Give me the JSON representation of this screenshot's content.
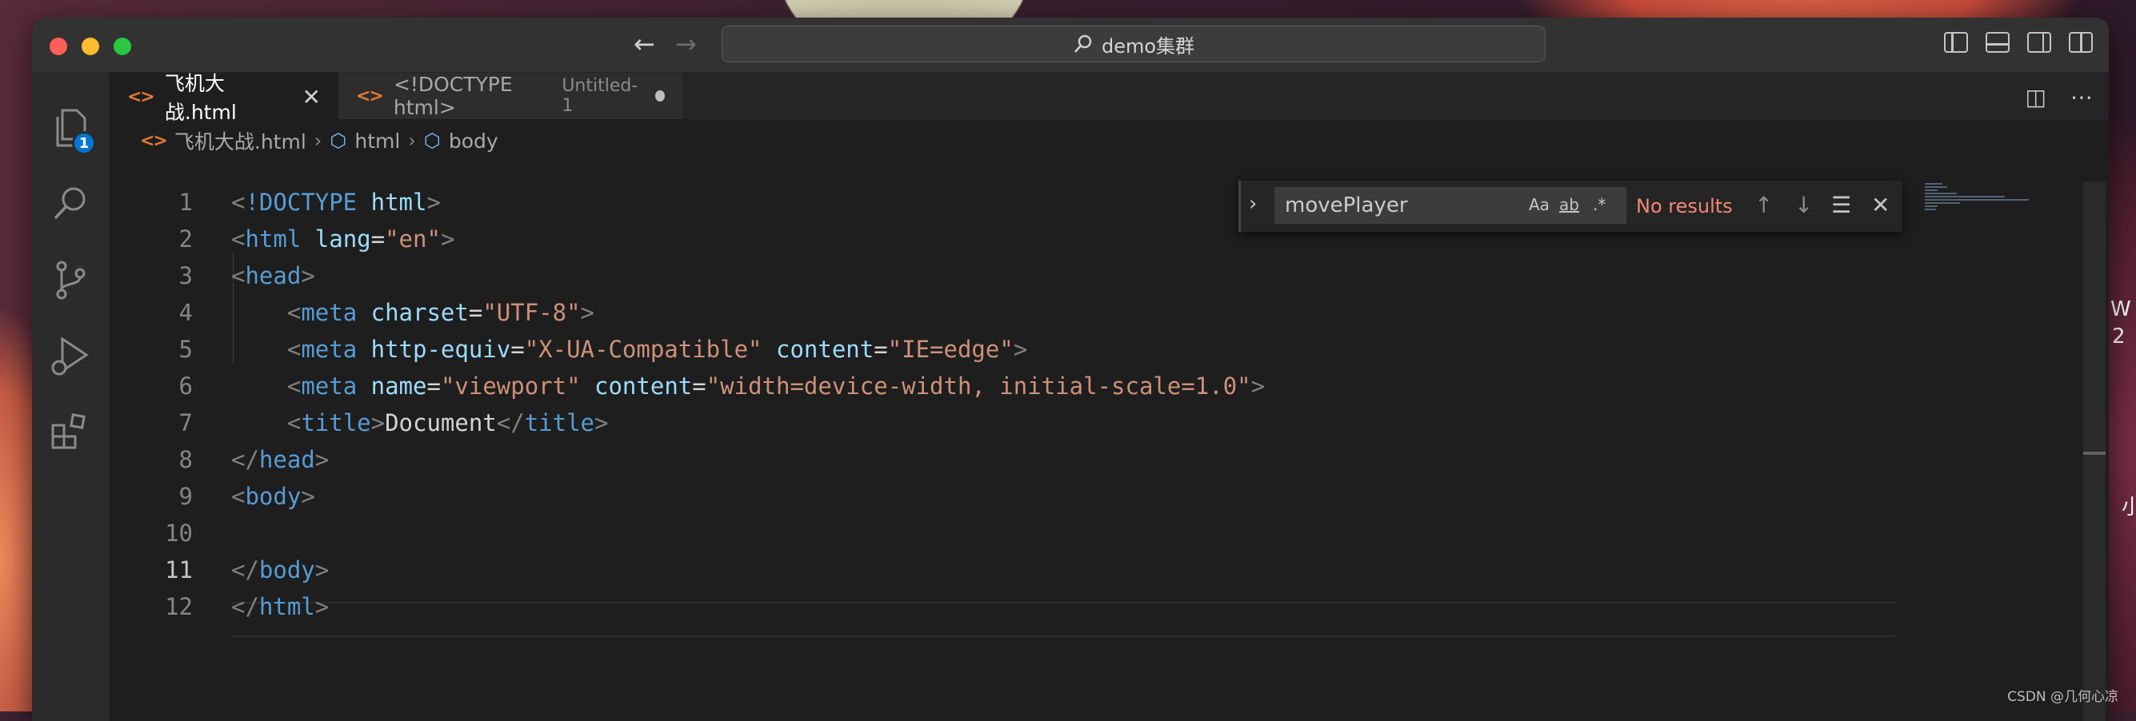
{
  "window": {
    "command_center_text": "demo集群"
  },
  "activity": {
    "explorer_badge": "1"
  },
  "tabs": [
    {
      "label": "飞机大战.html",
      "active": true
    },
    {
      "label": "<!DOCTYPE html>",
      "description": "Untitled-1",
      "active": false
    }
  ],
  "breadcrumb": [
    "飞机大战.html",
    "html",
    "body"
  ],
  "find": {
    "query": "movePlayer",
    "result": "No results",
    "opt_case": "Aa",
    "opt_word": "ab"
  },
  "editor": {
    "current_line": 11,
    "lines": [
      {
        "n": "1",
        "code": "<!DOCTYPE html>"
      },
      {
        "n": "2",
        "code": "<html lang=\"en\">"
      },
      {
        "n": "3",
        "code": "<head>"
      },
      {
        "n": "4",
        "code": "    <meta charset=\"UTF-8\">"
      },
      {
        "n": "5",
        "code": "    <meta http-equiv=\"X-UA-Compatible\" content=\"IE=edge\">"
      },
      {
        "n": "6",
        "code": "    <meta name=\"viewport\" content=\"width=device-width, initial-scale=1.0\">"
      },
      {
        "n": "7",
        "code": "    <title>Document</title>"
      },
      {
        "n": "8",
        "code": "</head>"
      },
      {
        "n": "9",
        "code": "<body>"
      },
      {
        "n": "10",
        "code": ""
      },
      {
        "n": "11",
        "code": "</body>"
      },
      {
        "n": "12",
        "code": "</html>"
      }
    ]
  },
  "desktop": {
    "right_text_1": "W",
    "right_text_2": "2",
    "right_text_3": "小"
  },
  "watermark": "CSDN @几何心凉",
  "colors": {
    "tag": "#569cd6",
    "attr": "#9cdcfe",
    "string": "#ce9178",
    "punct": "#808080",
    "find_result": "#f48771",
    "badge": "#0078d4"
  }
}
